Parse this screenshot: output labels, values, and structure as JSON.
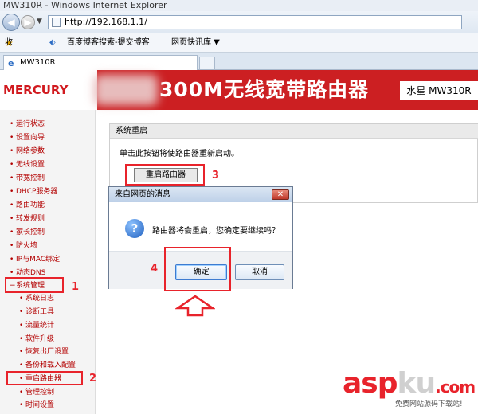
{
  "browser": {
    "window_title": "MW310R - Windows Internet Explorer",
    "url": "http://192.168.1.1/",
    "favorites_label": "收藏夹",
    "fav_links": [
      "百度博客搜索-提交博客",
      "网页快讯库 ▼"
    ],
    "tab_title": "MW310R"
  },
  "header": {
    "logo": "MERCURY",
    "title": "300M无线宽带路由器",
    "model": "水星 MW310R"
  },
  "sidebar": {
    "items": [
      "运行状态",
      "设置向导",
      "网络参数",
      "无线设置",
      "带宽控制",
      "DHCP服务器",
      "路由功能",
      "转发规则",
      "家长控制",
      "防火墙",
      "IP与MAC绑定",
      "动态DNS",
      "系统管理"
    ],
    "sub_items": [
      "系统日志",
      "诊断工具",
      "流量统计",
      "软件升级",
      "恢复出厂设置",
      "备份和载入配置",
      "重启路由器",
      "管理控制",
      "时间设置"
    ]
  },
  "panel": {
    "title": "系统重启",
    "description": "单击此按钮将使路由器重新启动。",
    "reboot_button": "重启路由器"
  },
  "dialog": {
    "title": "来自网页的消息",
    "message": "路由器将会重启，您确定要继续吗？",
    "ok": "确定",
    "cancel": "取消"
  },
  "annotations": [
    "1",
    "2",
    "3",
    "4"
  ],
  "watermark": {
    "brand_a": "asp",
    "brand_b": "ku",
    "brand_c": ".com",
    "sub": "免费网站源码下载站!"
  },
  "colors": {
    "accent": "#cc1f22",
    "annotation": "#e8232b",
    "nav_text": "#b30000"
  }
}
